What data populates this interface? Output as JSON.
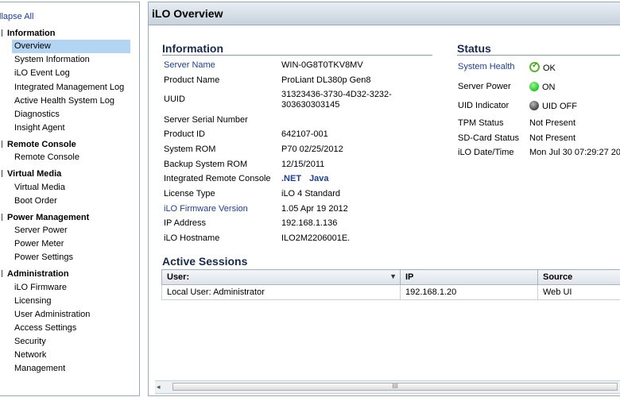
{
  "sidebar": {
    "collapse_label": "llapse All",
    "sections": [
      {
        "title": "Information",
        "items": [
          "Overview",
          "System Information",
          "iLO Event Log",
          "Integrated Management Log",
          "Active Health System Log",
          "Diagnostics",
          "Insight Agent"
        ]
      },
      {
        "title": "Remote Console",
        "items": [
          "Remote Console"
        ]
      },
      {
        "title": "Virtual Media",
        "items": [
          "Virtual Media",
          "Boot Order"
        ]
      },
      {
        "title": "Power Management",
        "items": [
          "Server Power",
          "Power Meter",
          "Power Settings"
        ]
      },
      {
        "title": "Administration",
        "items": [
          "iLO Firmware",
          "Licensing",
          "User Administration",
          "Access Settings",
          "Security",
          "Network",
          "Management"
        ]
      }
    ],
    "selected": "Overview"
  },
  "page": {
    "title": "iLO Overview"
  },
  "information": {
    "title": "Information",
    "rows": [
      {
        "label": "Server Name",
        "value": "WIN-0G8T0TKV8MV",
        "link": true
      },
      {
        "label": "Product Name",
        "value": "ProLiant DL380p Gen8"
      },
      {
        "label": "UUID",
        "value": "31323436-3730-4D32-3232-303630303145"
      },
      {
        "label": "Server Serial Number",
        "value": ""
      },
      {
        "label": "Product ID",
        "value": "642107-001"
      },
      {
        "label": "System ROM",
        "value": "P70 02/25/2012"
      },
      {
        "label": "Backup System ROM",
        "value": "12/15/2011"
      },
      {
        "label": "Integrated Remote Console",
        "value": ""
      },
      {
        "label": "License Type",
        "value": "iLO 4 Standard"
      },
      {
        "label": "iLO Firmware Version",
        "value": "1.05 Apr 19 2012",
        "link": true
      },
      {
        "label": "IP Address",
        "value": "192.168.1.136"
      },
      {
        "label": "iLO Hostname",
        "value": "ILO2M2206001E."
      }
    ],
    "uuid_line1": "31323436-3730-4D32-3232-",
    "uuid_line2": "303630303145",
    "console_links": [
      ".NET",
      "Java"
    ]
  },
  "status": {
    "title": "Status",
    "rows": [
      {
        "label": "System Health",
        "value": "OK",
        "icon": "check-icon",
        "link": true
      },
      {
        "label": "Server Power",
        "value": "ON",
        "icon": "power-on-icon"
      },
      {
        "label": "UID Indicator",
        "value": "UID OFF",
        "icon": "uid-off-icon"
      },
      {
        "label": "TPM Status",
        "value": "Not Present"
      },
      {
        "label": "SD-Card Status",
        "value": "Not Present"
      },
      {
        "label": "iLO Date/Time",
        "value": "Mon Jul 30 07:29:27 20"
      }
    ],
    "colors": {
      "ok": "#5cb531",
      "on": "#2fd12f",
      "off": "#555555"
    }
  },
  "sessions": {
    "title": "Active Sessions",
    "columns": [
      "User:",
      "IP",
      "Source"
    ],
    "rows": [
      [
        "Local User: Administrator",
        "192.168.1.20",
        "Web UI"
      ]
    ]
  },
  "scrollbar": {
    "thumb_label": "III"
  }
}
